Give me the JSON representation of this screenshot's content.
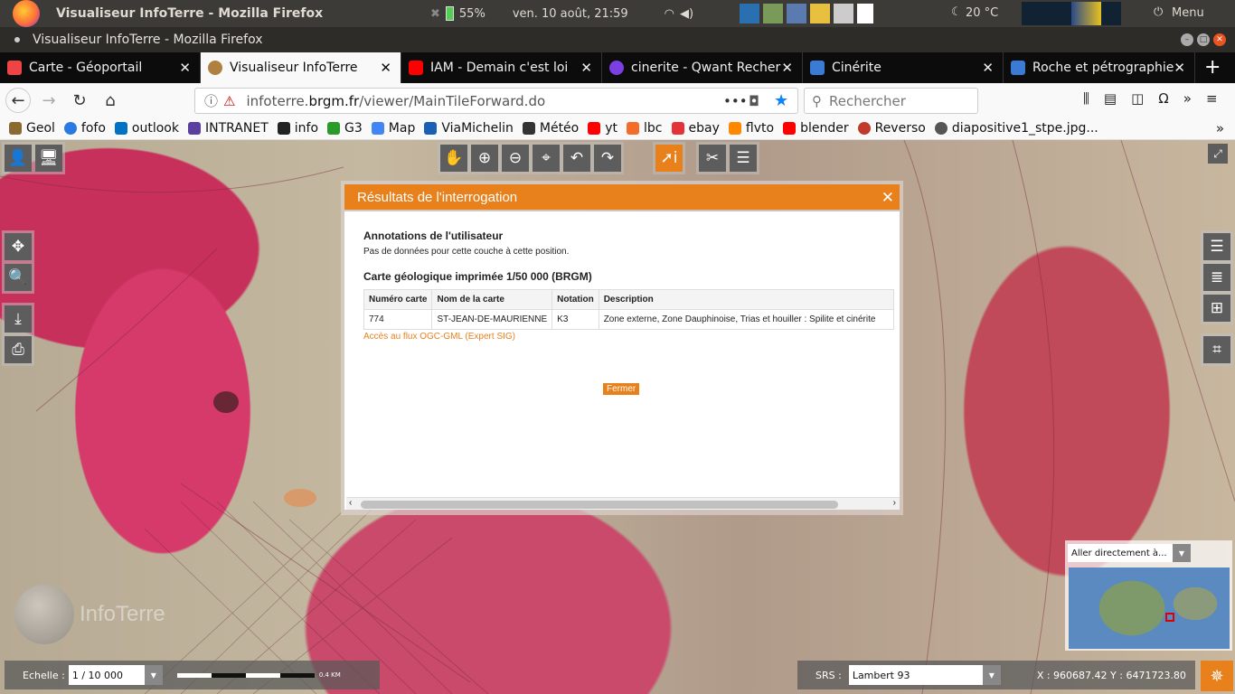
{
  "os": {
    "window_title": "Visualiseur InfoTerre - Mozilla Firefox",
    "battery": "55%",
    "clock": "ven. 10 août, 21:59",
    "weather": "20 °C",
    "menu": "Menu"
  },
  "window": {
    "title": "Visualiseur InfoTerre - Mozilla Firefox"
  },
  "tabs": [
    {
      "label": "Carte - Géoportail",
      "color": "#e44"
    },
    {
      "label": "Visualiseur InfoTerre",
      "color": "#b08040"
    },
    {
      "label": "IAM - Demain c'est loi",
      "color": "#f00"
    },
    {
      "label": "cinerite - Qwant Recher",
      "color": "#7b3fe4"
    },
    {
      "label": "Cinérite",
      "color": "#3a7bd5"
    },
    {
      "label": "Roche et pétrographie",
      "color": "#3a7bd5"
    }
  ],
  "nav": {
    "url_host": "infoterre.",
    "url_domain": "brgm.fr",
    "url_path": "/viewer/MainTileForward.do",
    "search_placeholder": "Rechercher",
    "more": "•••"
  },
  "bookmarks": [
    {
      "label": "Geol",
      "color": "#8a6a30"
    },
    {
      "label": "fofo",
      "color": "#2a7ae2"
    },
    {
      "label": "outlook",
      "color": "#0072c6"
    },
    {
      "label": "INTRANET",
      "color": "#5a3fa0"
    },
    {
      "label": "info",
      "color": "#222"
    },
    {
      "label": "G3",
      "color": "#2a9a2a"
    },
    {
      "label": "Map",
      "color": "#4285f4"
    },
    {
      "label": "ViaMichelin",
      "color": "#1a5fb4"
    },
    {
      "label": "Météo",
      "color": "#333"
    },
    {
      "label": "yt",
      "color": "#f00"
    },
    {
      "label": "lbc",
      "color": "#f56b2a"
    },
    {
      "label": "ebay",
      "color": "#e53238"
    },
    {
      "label": "flvto",
      "color": "#f80"
    },
    {
      "label": "blender",
      "color": "#f00"
    },
    {
      "label": "Reverso",
      "color": "#c0392b"
    },
    {
      "label": "diapositive1_stpe.jpg...",
      "color": "#555"
    }
  ],
  "dialog": {
    "title": "Résultats de l'interrogation",
    "section1_title": "Annotations de l'utilisateur",
    "section1_text": "Pas de données pour cette couche à cette position.",
    "section2_title": "Carte géologique imprimée 1/50 000 (BRGM)",
    "headers": [
      "Numéro carte",
      "Nom de la carte",
      "Notation",
      "Description"
    ],
    "row": [
      "774",
      "ST-JEAN-DE-MAURIENNE",
      "K3",
      "Zone externe, Zone Dauphinoise, Trias et houiller : Spilite et cinérite"
    ],
    "link": "Accès au flux OGC-GML (Expert SIG)",
    "close_button": "Fermer"
  },
  "bottom": {
    "scale_label": "Echelle :",
    "scale_value": "1 / 10 000",
    "scale_bar": "0.4 KM",
    "srs_label": "SRS :",
    "srs_value": "Lambert 93",
    "coords": "X : 960687.42 Y : 6471723.80"
  },
  "overview": {
    "goto_placeholder": "Aller directement à..."
  },
  "logo": "InfoTerre"
}
